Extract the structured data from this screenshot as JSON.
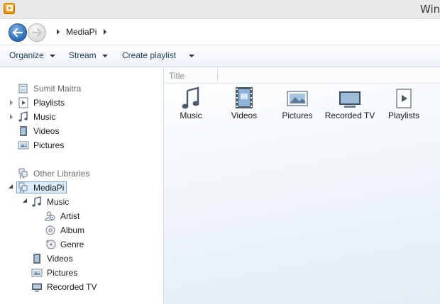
{
  "window": {
    "title": "Windows Media Player",
    "visible_title": "Win"
  },
  "nav": {
    "breadcrumb": "MediaPi"
  },
  "toolbar": {
    "organize": "Organize",
    "stream": "Stream",
    "create_playlist": "Create playlist"
  },
  "sidebar": {
    "user": "Sumit Maitra",
    "user_items": [
      {
        "label": "Playlists",
        "icon": "playlist-icon"
      },
      {
        "label": "Music",
        "icon": "music-note-icon"
      },
      {
        "label": "Videos",
        "icon": "video-icon"
      },
      {
        "label": "Pictures",
        "icon": "picture-icon"
      }
    ],
    "other_libraries": "Other Libraries",
    "library": "MediaPi",
    "library_items": {
      "music": "Music",
      "artist": "Artist",
      "album": "Album",
      "genre": "Genre",
      "videos": "Videos",
      "pictures": "Pictures",
      "recorded_tv": "Recorded TV"
    }
  },
  "main": {
    "column_title": "Title",
    "tiles": [
      {
        "label": "Music",
        "icon": "music-note-icon"
      },
      {
        "label": "Videos",
        "icon": "film-icon"
      },
      {
        "label": "Pictures",
        "icon": "picture-icon"
      },
      {
        "label": "Recorded TV",
        "icon": "tv-icon"
      },
      {
        "label": "Playlists",
        "icon": "playlist-icon"
      }
    ]
  },
  "colors": {
    "accent": "#2b6cb8",
    "selection": "#dcecfc",
    "app_icon": "#f0a020"
  }
}
